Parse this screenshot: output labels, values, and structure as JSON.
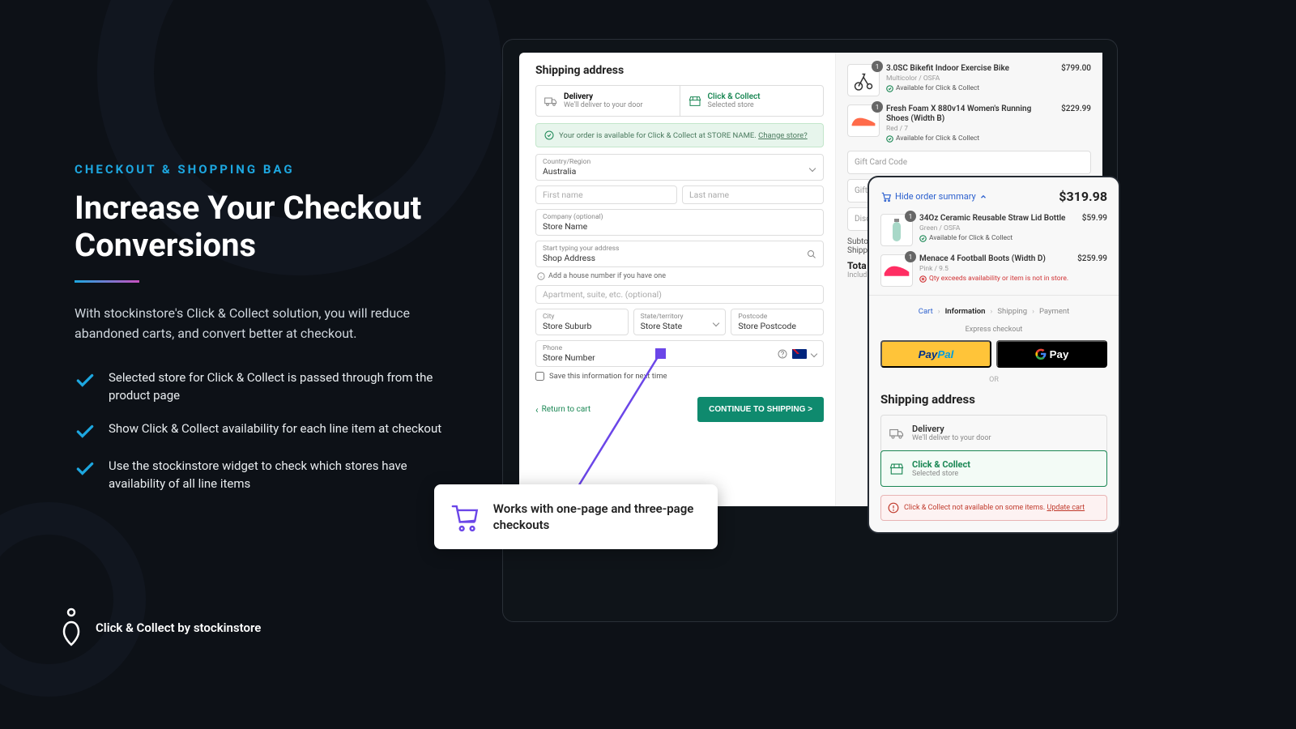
{
  "left": {
    "eyebrow": "CHECKOUT & SHOPPING BAG",
    "headline": "Increase Your Checkout Conversions",
    "subtext": "With stockinstore's Click & Collect solution, you will reduce abandoned carts, and convert better at checkout.",
    "features": [
      "Selected store for Click & Collect is passed through from the product page",
      "Show Click & Collect availability for each line item at checkout",
      "Use the stockinstore widget to check which stores have availability of all line items"
    ],
    "brand": "Click & Collect by stockinstore"
  },
  "callout": "Works with one-page and three-page checkouts",
  "checkout": {
    "title": "Shipping address",
    "methods": [
      {
        "label": "Delivery",
        "sub": "We'll deliver to your door"
      },
      {
        "label": "Click & Collect",
        "sub": "Selected store"
      }
    ],
    "availBanner": {
      "text": "Your order is available for Click & Collect at STORE NAME.",
      "link": "Change store?"
    },
    "country": {
      "label": "Country/Region",
      "value": "Australia"
    },
    "firstName": "First name",
    "lastName": "Last name",
    "company": {
      "label": "Company (optional)",
      "value": "Store Name"
    },
    "address": {
      "label": "Start typing your address",
      "value": "Shop Address"
    },
    "addrHint": "Add a house number if you have one",
    "apt": "Apartment, suite, etc. (optional)",
    "city": {
      "label": "City",
      "value": "Store Suburb"
    },
    "state": {
      "label": "State/territory",
      "value": "Store State"
    },
    "postcode": {
      "label": "Postcode",
      "value": "Store Postcode"
    },
    "phone": {
      "label": "Phone",
      "value": "Store Number"
    },
    "saveInfo": "Save this information for next time",
    "backLink": "Return to cart",
    "cta": "CONTINUE TO SHIPPING >"
  },
  "side": {
    "items": [
      {
        "qty": "1",
        "title": "3.0SC Bikefit Indoor Exercise Bike",
        "meta": "Multicolor / OSFA",
        "avail": "Available for Click & Collect",
        "price": "$799.00"
      },
      {
        "qty": "1",
        "title": "Fresh Foam X 880v14 Women's Running Shoes (Width B)",
        "meta": "Red / 7",
        "avail": "Available for Click & Collect",
        "price": "$229.99"
      }
    ],
    "giftCard": "Gift Card Code",
    "giftPin": "Gift",
    "discount": "Disc",
    "sub": "Subto",
    "ship": "Shippi",
    "totalLbl": "Tota",
    "incl": "Includ"
  },
  "panel2": {
    "hideLabel": "Hide order summary",
    "total": "$319.98",
    "items": [
      {
        "qty": "1",
        "title": "34Oz Ceramic Reusable Straw Lid Bottle",
        "meta": "Green / OSFA",
        "avail": "Available for Click & Collect",
        "price": "$59.99",
        "ok": true
      },
      {
        "qty": "1",
        "title": "Menace 4 Football Boots (Width D)",
        "meta": "Pink / 9.5",
        "err": "Qty exceeds availability or item is not in store.",
        "price": "$259.99",
        "ok": false
      }
    ],
    "crumbs": [
      "Cart",
      "Information",
      "Shipping",
      "Payment"
    ],
    "express": "Express checkout",
    "paypal": "PayPal",
    "gpay": "G Pay",
    "or": "OR",
    "shipTitle": "Shipping address",
    "methods": [
      {
        "label": "Delivery",
        "sub": "We'll deliver to your door"
      },
      {
        "label": "Click & Collect",
        "sub": "Selected store"
      }
    ],
    "warn": {
      "text": "Click & Collect not available on some items.",
      "link": "Update cart"
    }
  }
}
